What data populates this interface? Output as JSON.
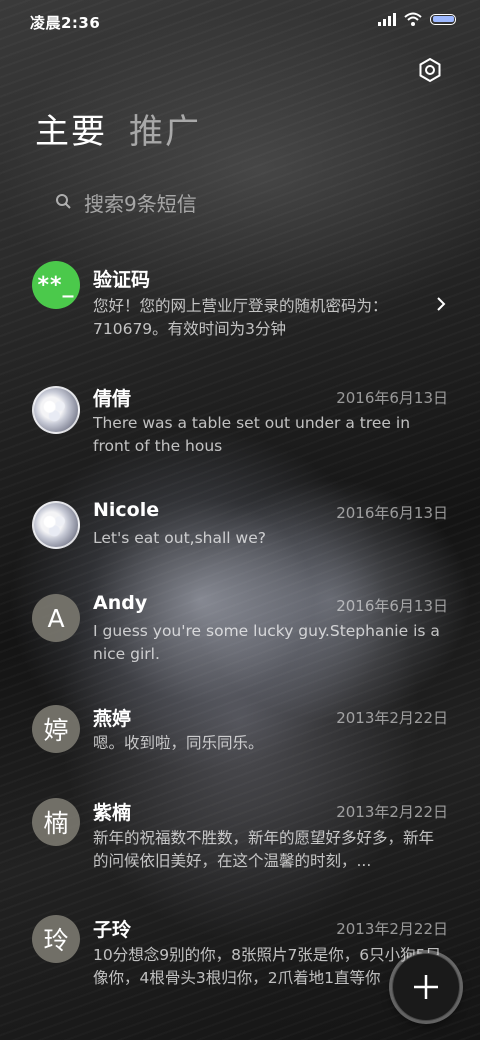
{
  "status_bar": {
    "time": "凌晨2:36",
    "battery_level": 1.0,
    "battery_color": "#9db8ff"
  },
  "header": {
    "settings_icon": "settings-icon"
  },
  "tabs": [
    {
      "label": "主要",
      "active": true
    },
    {
      "label": "推广",
      "active": false
    }
  ],
  "search": {
    "placeholder": "搜索9条短信"
  },
  "conversations": [
    {
      "name": "验证码",
      "avatar_text": "**_",
      "avatar_type": "green",
      "date": "",
      "preview": "您好！您的网上营业厅登录的随机密码为：710679。有效时间为3分钟",
      "has_chevron": true
    },
    {
      "name": "倩倩",
      "avatar_text": "",
      "avatar_type": "photo",
      "date": "2016年6月13日",
      "preview": "There was a table set out under a tree in front of the hous"
    },
    {
      "name": "Nicole",
      "avatar_text": "",
      "avatar_type": "photo",
      "date": "2016年6月13日",
      "preview": "Let's eat out,shall we?"
    },
    {
      "name": "Andy",
      "avatar_text": "A",
      "avatar_type": "gray",
      "date": "2016年6月13日",
      "preview": "I guess you're some lucky guy.Stephanie is a nice girl."
    },
    {
      "name": "燕婷",
      "avatar_text": "婷",
      "avatar_type": "gray",
      "date": "2013年2月22日",
      "preview": "嗯。收到啦，同乐同乐。"
    },
    {
      "name": "紫楠",
      "avatar_text": "楠",
      "avatar_type": "gray",
      "date": "2013年2月22日",
      "preview": "新年的祝福数不胜数，新年的愿望好多好多，新年的问候依旧美好，在这个温馨的时刻，..."
    },
    {
      "name": "子玲",
      "avatar_text": "玲",
      "avatar_type": "gray",
      "date": "2013年2月22日",
      "preview": "10分想念9别的你，8张照片7张是你，6只小狗5只像你，4根骨头3根归你，2爪着地1直等你"
    }
  ],
  "fab": {
    "icon": "plus-icon"
  }
}
